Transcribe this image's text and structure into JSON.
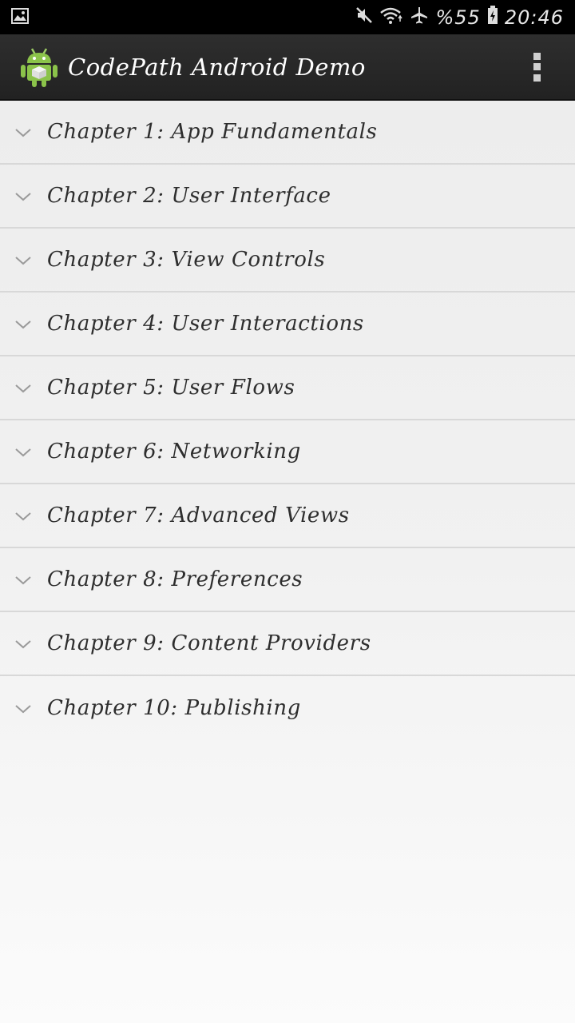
{
  "status_bar": {
    "icons": [
      "image-notification-icon",
      "mute-icon",
      "wifi-icon",
      "airplane-icon",
      "battery-icon"
    ],
    "battery_text": "%55",
    "clock": "20:46"
  },
  "action_bar": {
    "icon": "android-app-icon",
    "title": "CodePath Android Demo",
    "overflow_icon": "overflow-menu-icon"
  },
  "chapters": [
    {
      "label": "Chapter 1: App Fundamentals"
    },
    {
      "label": "Chapter 2: User Interface"
    },
    {
      "label": "Chapter 3: View Controls"
    },
    {
      "label": "Chapter 4: User Interactions"
    },
    {
      "label": "Chapter 5: User Flows"
    },
    {
      "label": "Chapter 6: Networking"
    },
    {
      "label": "Chapter 7: Advanced Views"
    },
    {
      "label": "Chapter 8: Preferences"
    },
    {
      "label": "Chapter 9: Content Providers"
    },
    {
      "label": "Chapter 10: Publishing"
    }
  ],
  "colors": {
    "status_bar_bg": "#000000",
    "action_bar_bg": "#262626",
    "list_text": "#2e2e2e",
    "divider": "#d8d8d8",
    "android_green": "#8bc34a"
  }
}
